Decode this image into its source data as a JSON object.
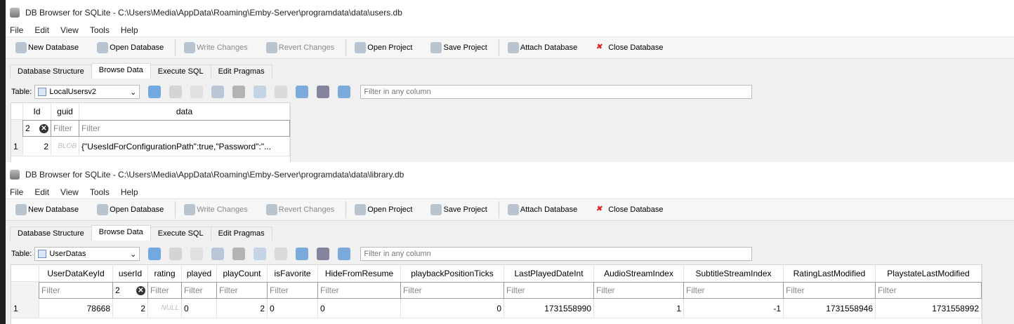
{
  "windows": [
    {
      "title": "DB Browser for SQLite - C:\\Users\\Media\\AppData\\Roaming\\Emby-Server\\programdata\\data\\users.db",
      "table": "LocalUsersv2",
      "columns": [
        {
          "name": "Id",
          "filter": "2",
          "filter_clear": true
        },
        {
          "name": "guid",
          "filter": "Filter"
        },
        {
          "name": "data",
          "filter": "Filter"
        }
      ],
      "rows": [
        {
          "num": "1",
          "cells": [
            {
              "v": "2",
              "t": "num"
            },
            {
              "v": "BLOB",
              "t": "null"
            },
            {
              "v": "{\"UsesIdForConfigurationPath\":true,\"Password\":\"...",
              "t": "text"
            }
          ]
        }
      ]
    },
    {
      "title": "DB Browser for SQLite - C:\\Users\\Media\\AppData\\Roaming\\Emby-Server\\programdata\\data\\library.db",
      "table": "UserDatas",
      "columns": [
        {
          "name": "UserDataKeyId",
          "filter": "Filter"
        },
        {
          "name": "userId",
          "filter": "2",
          "filter_clear": true
        },
        {
          "name": "rating",
          "filter": "Filter"
        },
        {
          "name": "played",
          "filter": "Filter"
        },
        {
          "name": "playCount",
          "filter": "Filter"
        },
        {
          "name": "isFavorite",
          "filter": "Filter"
        },
        {
          "name": "HideFromResume",
          "filter": "Filter"
        },
        {
          "name": "playbackPositionTicks",
          "filter": "Filter"
        },
        {
          "name": "LastPlayedDateInt",
          "filter": "Filter"
        },
        {
          "name": "AudioStreamIndex",
          "filter": "Filter"
        },
        {
          "name": "SubtitleStreamIndex",
          "filter": "Filter"
        },
        {
          "name": "RatingLastModified",
          "filter": "Filter"
        },
        {
          "name": "PlaystateLastModified",
          "filter": "Filter"
        }
      ],
      "rows": [
        {
          "num": "1",
          "cells": [
            {
              "v": "78668",
              "t": "num"
            },
            {
              "v": "2",
              "t": "num"
            },
            {
              "v": "NULL",
              "t": "null"
            },
            {
              "v": "0",
              "t": "text"
            },
            {
              "v": "2",
              "t": "num"
            },
            {
              "v": "0",
              "t": "text"
            },
            {
              "v": "0",
              "t": "text"
            },
            {
              "v": "0",
              "t": "num"
            },
            {
              "v": "1731558990",
              "t": "num"
            },
            {
              "v": "1",
              "t": "num"
            },
            {
              "v": "-1",
              "t": "num"
            },
            {
              "v": "1731558946",
              "t": "num"
            },
            {
              "v": "1731558992",
              "t": "num"
            }
          ]
        }
      ]
    }
  ],
  "menu": [
    "File",
    "Edit",
    "View",
    "Tools",
    "Help"
  ],
  "toolbar": [
    {
      "label": "New Database",
      "enabled": true
    },
    {
      "label": "Open Database",
      "enabled": true
    },
    {
      "label": "Write Changes",
      "enabled": false
    },
    {
      "label": "Revert Changes",
      "enabled": false
    },
    {
      "label": "Open Project",
      "enabled": true
    },
    {
      "label": "Save Project",
      "enabled": true
    },
    {
      "label": "Attach Database",
      "enabled": true
    },
    {
      "label": "Close Database",
      "enabled": true
    }
  ],
  "tabs": [
    "Database Structure",
    "Browse Data",
    "Execute SQL",
    "Edit Pragmas"
  ],
  "active_tab": "Browse Data",
  "table_label": "Table:",
  "filter_placeholder": "Filter in any column",
  "clear_glyph": "✕"
}
